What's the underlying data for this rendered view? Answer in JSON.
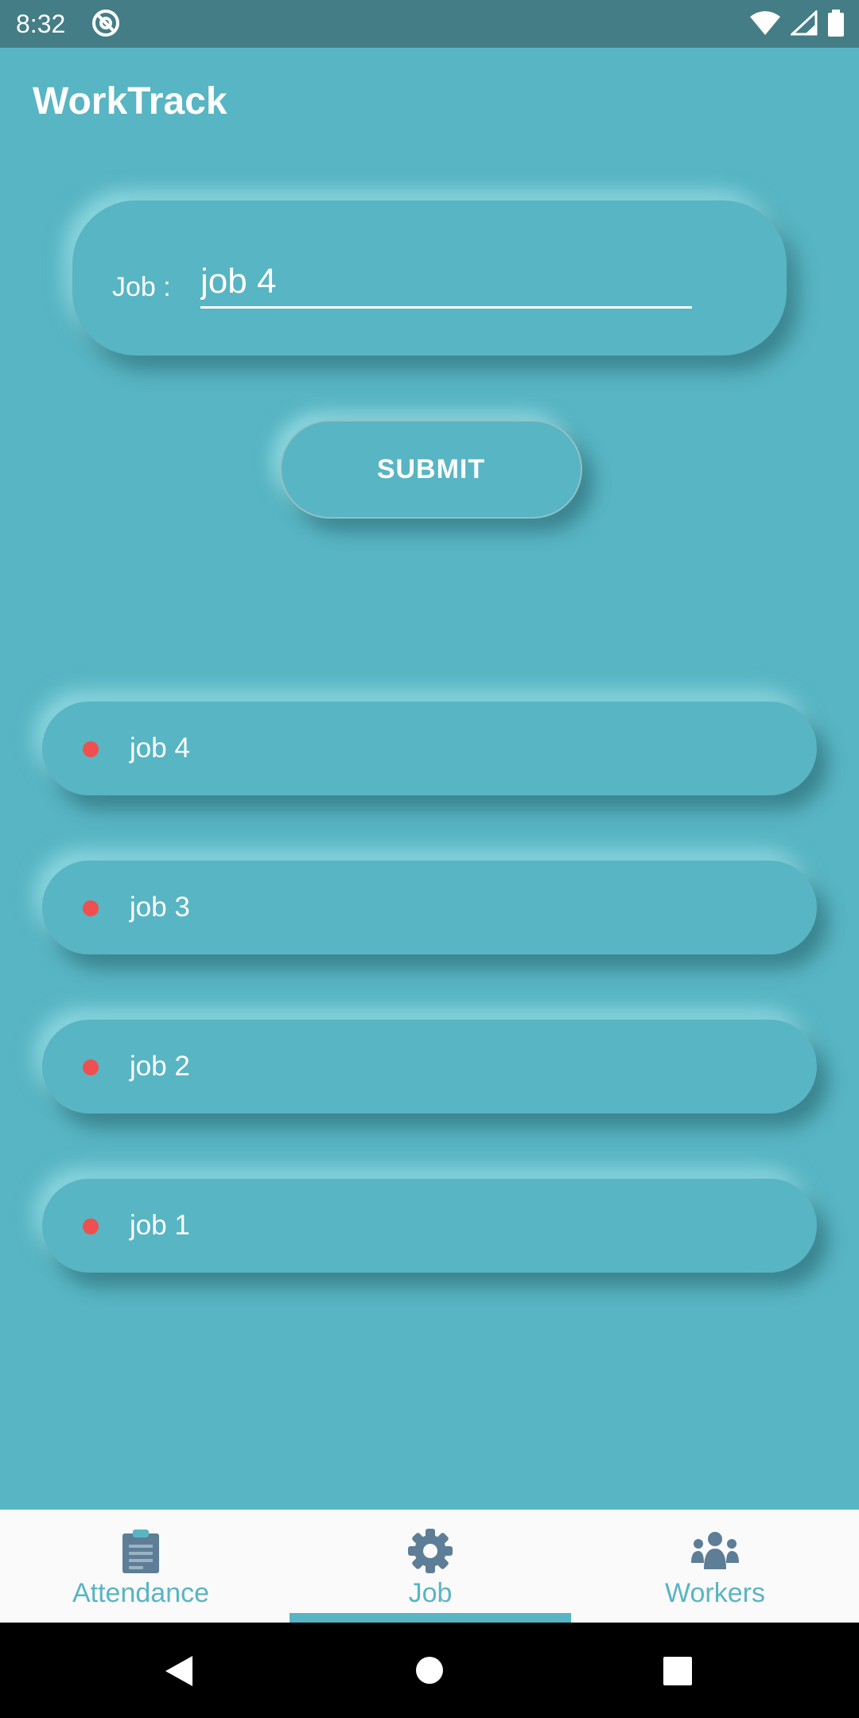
{
  "status_bar": {
    "time": "8:32"
  },
  "app": {
    "title": "WorkTrack"
  },
  "job_form": {
    "label": "Job :",
    "value": "job 4",
    "submit_label": "SUBMIT"
  },
  "jobs": [
    "job 4",
    "job 3",
    "job 2",
    "job 1"
  ],
  "bottom_nav": {
    "tabs": [
      {
        "label": "Attendance",
        "icon": "clipboard-icon"
      },
      {
        "label": "Job",
        "icon": "gear-icon",
        "selected": true
      },
      {
        "label": "Workers",
        "icon": "workers-icon"
      }
    ]
  },
  "colors": {
    "background": "#58b5c3",
    "status_bar": "#447d86",
    "dot": "#ef4f4f",
    "nav_icon": "#5e7d96"
  }
}
